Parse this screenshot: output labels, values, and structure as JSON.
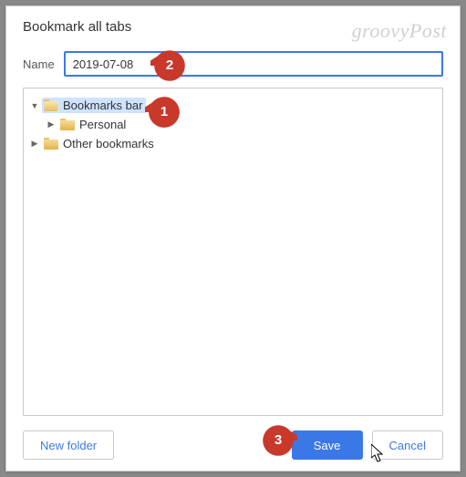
{
  "watermark": "groovyPost",
  "dialog": {
    "title": "Bookmark all tabs",
    "name_label": "Name",
    "name_value": "2019-07-08"
  },
  "tree": {
    "items": [
      {
        "label": "Bookmarks bar",
        "expanded": true,
        "selected": true,
        "depth": 0
      },
      {
        "label": "Personal",
        "expanded": false,
        "selected": false,
        "depth": 1
      },
      {
        "label": "Other bookmarks",
        "expanded": false,
        "selected": false,
        "depth": 0
      }
    ]
  },
  "buttons": {
    "new_folder": "New folder",
    "save": "Save",
    "cancel": "Cancel"
  },
  "callouts": {
    "c1": "1",
    "c2": "2",
    "c3": "3"
  }
}
